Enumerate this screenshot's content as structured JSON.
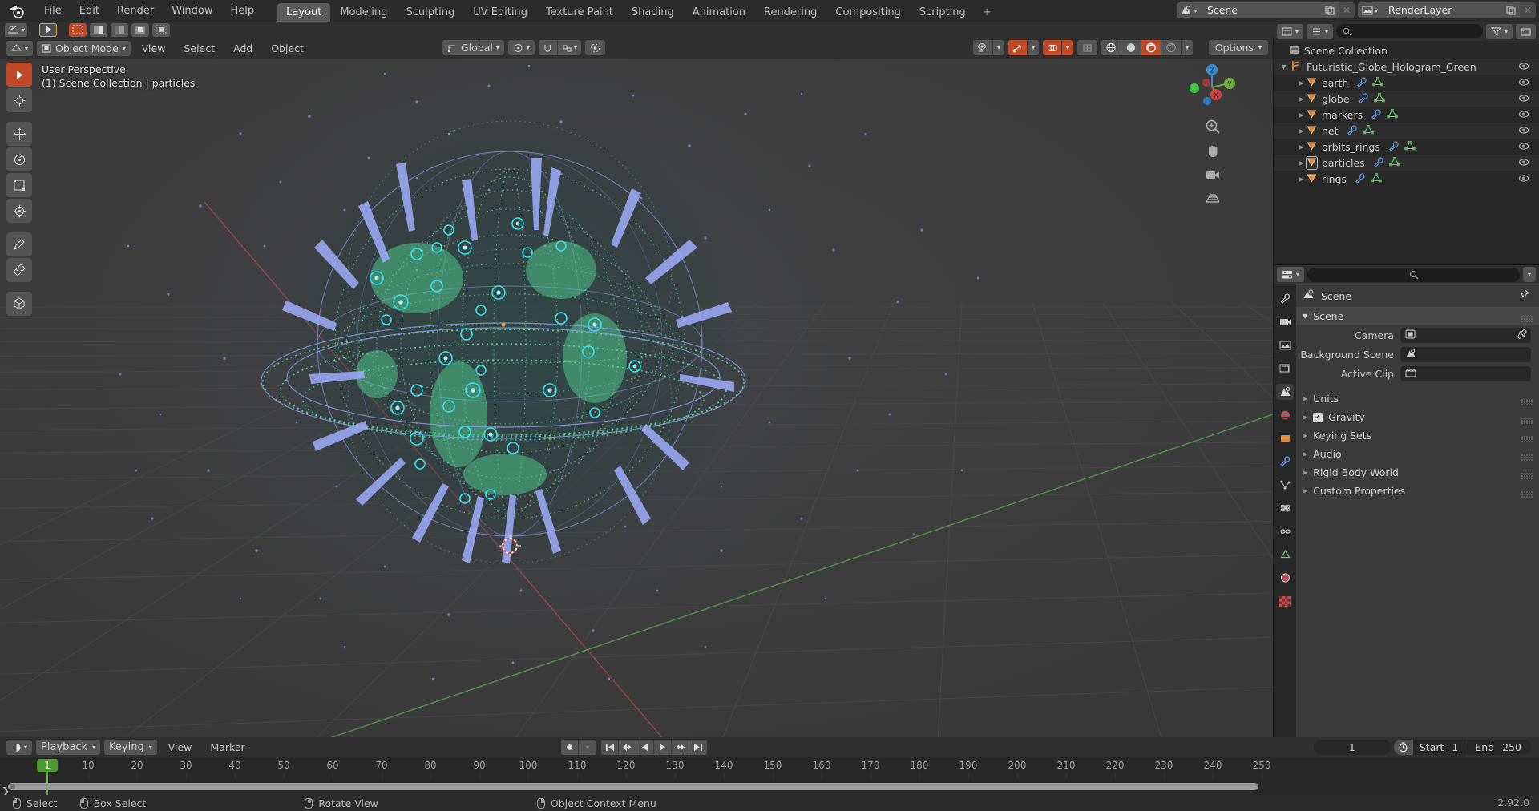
{
  "app": {
    "name": "Blender",
    "version": "2.92.0"
  },
  "topbar": {
    "menus": [
      "File",
      "Edit",
      "Render",
      "Window",
      "Help"
    ],
    "workspaces": [
      {
        "label": "Layout",
        "active": true
      },
      {
        "label": "Modeling",
        "active": false
      },
      {
        "label": "Sculpting",
        "active": false
      },
      {
        "label": "UV Editing",
        "active": false
      },
      {
        "label": "Texture Paint",
        "active": false
      },
      {
        "label": "Shading",
        "active": false
      },
      {
        "label": "Animation",
        "active": false
      },
      {
        "label": "Rendering",
        "active": false
      },
      {
        "label": "Compositing",
        "active": false
      },
      {
        "label": "Scripting",
        "active": false
      }
    ],
    "add_workspace_label": "+",
    "scene_name": "Scene",
    "view_layer_name": "RenderLayer"
  },
  "viewport_header": {
    "mode": "Object Mode",
    "menus": [
      "View",
      "Select",
      "Add",
      "Object"
    ],
    "transform_orientation": "Global",
    "options_label": "Options"
  },
  "viewport_overlay": {
    "perspective": "User Perspective",
    "collection_info": "(1) Scene Collection | particles"
  },
  "gizmo": {
    "axes": [
      "Z",
      "Y",
      "X"
    ],
    "color_x": "#e04a4a",
    "color_y": "#7bc043",
    "color_z": "#3a8fd4"
  },
  "outliner": {
    "root": "Scene Collection",
    "items": [
      {
        "label": "Futuristic_Globe_Hologram_Green",
        "depth": 1,
        "type": "collection",
        "expanded": true
      },
      {
        "label": "earth",
        "depth": 2,
        "type": "mesh",
        "expanded": false
      },
      {
        "label": "globe",
        "depth": 2,
        "type": "mesh",
        "expanded": false
      },
      {
        "label": "markers",
        "depth": 2,
        "type": "mesh",
        "expanded": false
      },
      {
        "label": "net",
        "depth": 2,
        "type": "mesh",
        "expanded": false
      },
      {
        "label": "orbits_rings",
        "depth": 2,
        "type": "mesh",
        "expanded": false
      },
      {
        "label": "particles",
        "depth": 2,
        "type": "mesh",
        "expanded": false,
        "selected": true
      },
      {
        "label": "rings",
        "depth": 2,
        "type": "mesh",
        "expanded": false
      }
    ]
  },
  "properties": {
    "breadcrumb": "Scene",
    "panel_title": "Scene",
    "fields": [
      {
        "label": "Camera",
        "value": "",
        "icon": "camera-icon"
      },
      {
        "label": "Background Scene",
        "value": "",
        "icon": "scene-icon"
      },
      {
        "label": "Active Clip",
        "value": "",
        "icon": "clip-icon"
      }
    ],
    "sections": [
      {
        "label": "Units",
        "checkbox": false
      },
      {
        "label": "Gravity",
        "checkbox": true
      },
      {
        "label": "Keying Sets",
        "checkbox": false
      },
      {
        "label": "Audio",
        "checkbox": false
      },
      {
        "label": "Rigid Body World",
        "checkbox": false
      },
      {
        "label": "Custom Properties",
        "checkbox": false
      }
    ]
  },
  "timeline": {
    "menus": [
      "Playback",
      "Keying",
      "View",
      "Marker"
    ],
    "current_frame": "1",
    "start_label": "Start",
    "start_value": "1",
    "end_label": "End",
    "end_value": "250",
    "ticks": [
      "10",
      "20",
      "30",
      "40",
      "50",
      "60",
      "70",
      "80",
      "90",
      "100",
      "110",
      "120",
      "130",
      "140",
      "150",
      "160",
      "170",
      "180",
      "190",
      "200",
      "210",
      "220",
      "230",
      "240",
      "250"
    ],
    "playhead_frame": "1"
  },
  "status_bar": {
    "items": [
      {
        "mouse": "left",
        "label": "Select"
      },
      {
        "mouse": "left-drag",
        "label": "Box Select"
      },
      {
        "mouse": "middle",
        "label": "Rotate View"
      },
      {
        "mouse": "right",
        "label": "Object Context Menu"
      }
    ],
    "version": "2.92.0"
  }
}
